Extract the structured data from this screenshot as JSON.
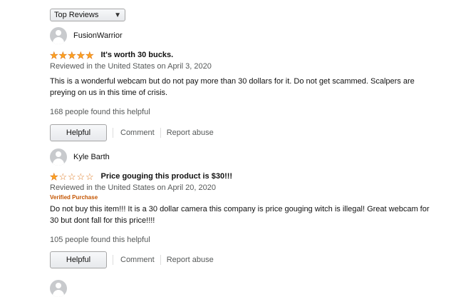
{
  "sort": {
    "selected": "Top Reviews"
  },
  "reviews": [
    {
      "author": "FusionWarrior",
      "rating": 5,
      "title": "It's worth 30 bucks.",
      "meta": "Reviewed in the United States on April 3, 2020",
      "verified": "",
      "body": "This is a wonderful webcam but do not pay more than 30 dollars for it. Do not get scammed. Scalpers are preying on us in this time of crisis.",
      "helpful_count": "168 people found this helpful",
      "helpful_label": "Helpful",
      "comment_label": "Comment",
      "report_label": "Report abuse"
    },
    {
      "author": "Kyle Barth",
      "rating": 1,
      "title": "Price gouging this product is $30!!!",
      "meta": "Reviewed in the United States on April 20, 2020",
      "verified": "Verified Purchase",
      "body": "Do not buy this item!!! It is a 30 dollar camera this company is price gouging witch is illegal! Great webcam for 30 but dont fall for this price!!!!",
      "helpful_count": "105 people found this helpful",
      "helpful_label": "Helpful",
      "comment_label": "Comment",
      "report_label": "Report abuse"
    }
  ],
  "colors": {
    "star": "#ffa41c",
    "verified": "#c45500",
    "meta": "#565959"
  },
  "icons": {
    "star": "star-icon",
    "avatar": "avatar-icon",
    "dropdown": "chevron-down-icon"
  }
}
